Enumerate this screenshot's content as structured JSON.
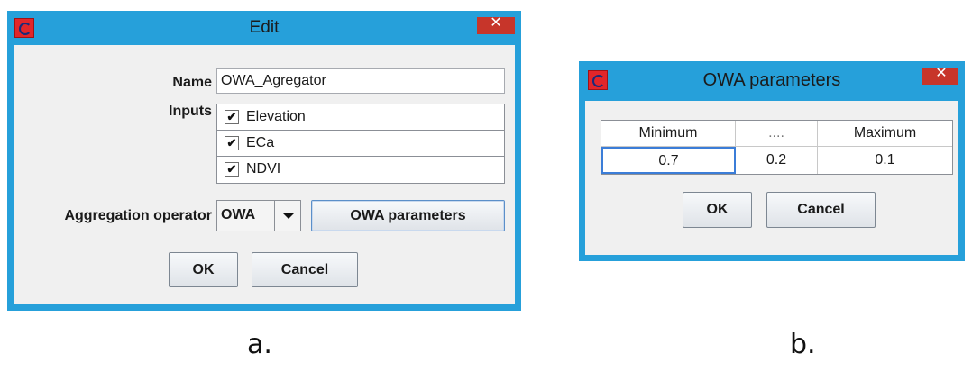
{
  "edit_dialog": {
    "title": "Edit",
    "close_glyph": "✕",
    "name_label": "Name",
    "name_value": "OWA_Agregator",
    "inputs_label": "Inputs",
    "inputs": [
      {
        "label": "Elevation",
        "checked": true
      },
      {
        "label": "ECa",
        "checked": true
      },
      {
        "label": "NDVI",
        "checked": true
      }
    ],
    "check_glyph": "✔",
    "aggregation_label": "Aggregation operator",
    "aggregation_value": "OWA",
    "owa_parameters_button": "OWA parameters",
    "ok_button": "OK",
    "cancel_button": "Cancel"
  },
  "owa_dialog": {
    "title": "OWA parameters",
    "close_glyph": "✕",
    "columns": [
      "Minimum",
      "....",
      "Maximum"
    ],
    "values": [
      "0.7",
      "0.2",
      "0.1"
    ],
    "ok_button": "OK",
    "cancel_button": "Cancel"
  },
  "captions": {
    "a": "a.",
    "b": "b."
  },
  "colors": {
    "titlebar": "#26a0da",
    "close": "#c7352a",
    "client": "#f0f0f0"
  }
}
